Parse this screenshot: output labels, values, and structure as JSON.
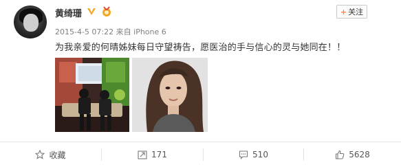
{
  "post": {
    "user_name": "黄绮珊",
    "follow_label": "关注",
    "follow_plus": "+",
    "date": "2015-4-5 07:22",
    "source_prefix": "来自",
    "device": "iPhone 6",
    "text": "为我亲爱的何晴姊妹每日守望祷告，愿医治的手与信心的灵与她同在！！"
  },
  "actions": {
    "favorite_label": "收藏",
    "repost_count": "171",
    "comment_count": "510",
    "like_count": "5628"
  },
  "colors": {
    "accent": "#ff8140",
    "meta_text": "#808080",
    "vip": "#f5a623"
  },
  "icons": [
    "vip-badge-icon",
    "medal-icon",
    "star-icon",
    "repost-icon",
    "comment-icon",
    "like-icon"
  ]
}
